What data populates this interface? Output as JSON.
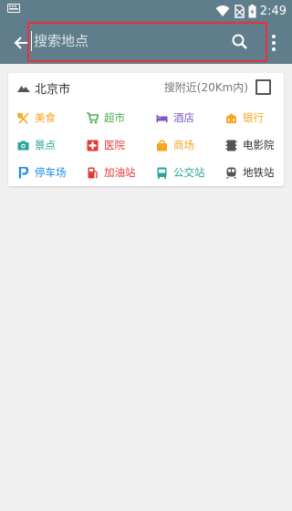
{
  "status": {
    "time": "2:49"
  },
  "search": {
    "placeholder": "搜索地点",
    "value": ""
  },
  "card": {
    "city": "北京市",
    "nearby_label": "搜附近(20Km内)",
    "nearby_checked": false
  },
  "categories": [
    {
      "label": "美食",
      "icon": "fork-knife-icon",
      "color": "#f5a623"
    },
    {
      "label": "超市",
      "icon": "cart-icon",
      "color": "#4caf50"
    },
    {
      "label": "酒店",
      "icon": "bed-icon",
      "color": "#7e57c2"
    },
    {
      "label": "银行",
      "icon": "bank-icon",
      "color": "#f5a623"
    },
    {
      "label": "景点",
      "icon": "camera-icon",
      "color": "#26a69a"
    },
    {
      "label": "医院",
      "icon": "hospital-cross-icon",
      "color": "#e53935"
    },
    {
      "label": "商场",
      "icon": "shopping-bag-icon",
      "color": "#f5a623"
    },
    {
      "label": "电影院",
      "icon": "film-icon",
      "color": "#555555"
    },
    {
      "label": "停车场",
      "icon": "parking-icon",
      "color": "#1e88e5"
    },
    {
      "label": "加油站",
      "icon": "gas-station-icon",
      "color": "#e53935"
    },
    {
      "label": "公交站",
      "icon": "bus-icon",
      "color": "#26a69a"
    },
    {
      "label": "地铁站",
      "icon": "subway-icon",
      "color": "#555555"
    }
  ],
  "theme": {
    "toolbar": "#607d8b",
    "highlight_border": "#e8313b"
  }
}
